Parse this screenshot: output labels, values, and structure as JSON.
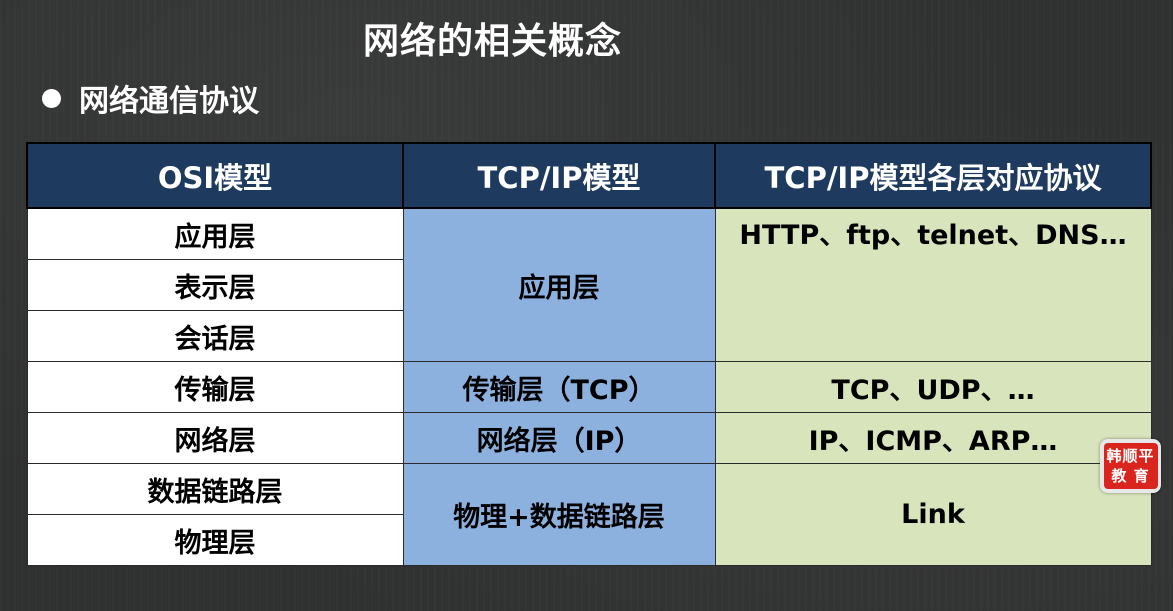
{
  "slide": {
    "title": "网络的相关概念",
    "bullet": "网络通信协议"
  },
  "table": {
    "headers": [
      "OSI模型",
      "TCP/IP模型",
      "TCP/IP模型各层对应协议"
    ],
    "osi_layers": [
      "应用层",
      "表示层",
      "会话层",
      "传输层",
      "网络层",
      "数据链路层",
      "物理层"
    ],
    "tcpip_layers": [
      "应用层",
      "传输层（TCP）",
      "网络层（IP）",
      "物理+数据链路层"
    ],
    "protocols": [
      "HTTP、ftp、telnet、DNS…",
      "TCP、UDP、…",
      "IP、ICMP、ARP…",
      "Link"
    ]
  },
  "logo": {
    "line1": "韩顺平",
    "line2": "教 育"
  },
  "colors": {
    "header_bg": "#1f3a5f",
    "tcp_col_bg": "#8db1df",
    "proto_col_bg": "#d8e4bc",
    "logo_red": "#d9251d"
  }
}
